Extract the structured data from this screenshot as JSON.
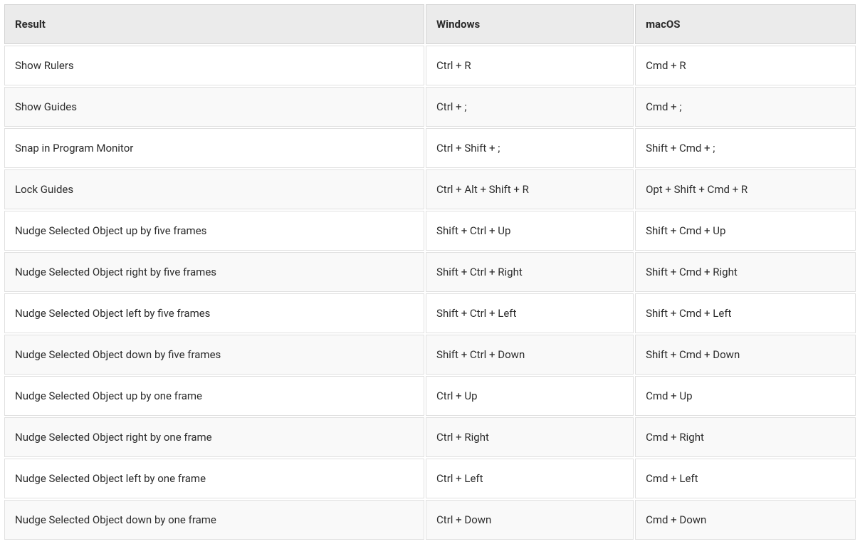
{
  "table": {
    "headers": {
      "result": "Result",
      "windows": "Windows",
      "macos": "macOS"
    },
    "rows": [
      {
        "result": "Show Rulers",
        "windows": "Ctrl + R",
        "macos": "Cmd + R"
      },
      {
        "result": "Show Guides",
        "windows": "Ctrl + ;",
        "macos": "Cmd + ;"
      },
      {
        "result": "Snap in Program Monitor",
        "windows": "Ctrl + Shift + ;",
        "macos": "Shift + Cmd + ;"
      },
      {
        "result": "Lock Guides",
        "windows": "Ctrl + Alt + Shift + R",
        "macos": "Opt + Shift + Cmd + R"
      },
      {
        "result": "Nudge Selected Object up by five frames",
        "windows": "Shift + Ctrl + Up",
        "macos": "Shift + Cmd + Up"
      },
      {
        "result": "Nudge Selected Object right by five frames",
        "windows": "Shift + Ctrl + Right",
        "macos": "Shift + Cmd + Right"
      },
      {
        "result": "Nudge Selected Object left by five frames",
        "windows": "Shift + Ctrl + Left",
        "macos": "Shift + Cmd + Left"
      },
      {
        "result": "Nudge Selected Object down by five frames",
        "windows": "Shift + Ctrl + Down",
        "macos": "Shift + Cmd + Down"
      },
      {
        "result": "Nudge Selected Object up by one frame",
        "windows": "Ctrl + Up",
        "macos": "Cmd + Up"
      },
      {
        "result": "Nudge Selected Object right by one frame",
        "windows": "Ctrl + Right",
        "macos": "Cmd + Right"
      },
      {
        "result": "Nudge Selected Object left by one frame",
        "windows": "Ctrl + Left",
        "macos": "Cmd + Left"
      },
      {
        "result": "Nudge Selected Object down by one frame",
        "windows": "Ctrl + Down",
        "macos": "Cmd + Down"
      }
    ]
  }
}
